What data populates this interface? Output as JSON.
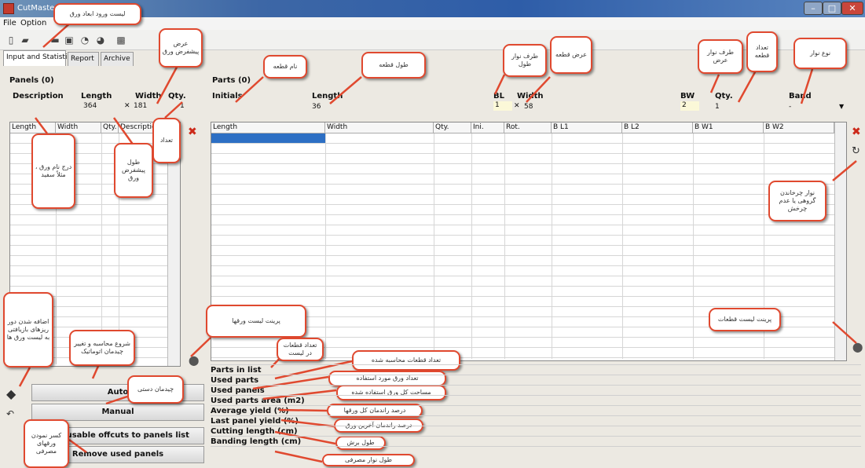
{
  "window": {
    "title": "CutMaste",
    "min": "–",
    "max": "□",
    "close": "✕"
  },
  "menu": {
    "file": "File",
    "options": "Option"
  },
  "tabs": [
    "Input and Statistics",
    "Report",
    "Archive"
  ],
  "panels": {
    "title": "Panels (0)",
    "desc_header": "Description",
    "length_header": "Length",
    "width_header": "Width",
    "qty_header": "Qty.",
    "length": "364",
    "width": "181",
    "qty": "1",
    "times": "✕",
    "grid_cols": [
      "Length",
      "Width",
      "Qty.",
      "Description"
    ]
  },
  "parts": {
    "title": "Parts (0)",
    "initials_header": "Initials",
    "length_header": "Length",
    "bl_header": "BL",
    "width_header": "Width",
    "bw_header": "BW",
    "qty_header": "Qty.",
    "band_header": "Band",
    "length": "36",
    "bl": "1",
    "width": "58",
    "bw": "2",
    "qty": "1",
    "band": "-",
    "times": "✕",
    "grid_cols": [
      "Length",
      "Width",
      "Qty.",
      "Ini.",
      "Rot.",
      "B L1",
      "B L2",
      "B W1",
      "B W2"
    ]
  },
  "buttons": {
    "auto": "Auto",
    "manual": "Manual",
    "add_offcuts": "Add usable offcuts to panels list",
    "remove_used": "Remove used panels"
  },
  "stats": [
    "Parts in list",
    "Used parts",
    "Used panels",
    "Used parts area (m2)",
    "Average yield (%)",
    "Last panel yield (%)",
    "Cutting length (cm)",
    "Banding length (cm)"
  ],
  "callouts": {
    "c1": "لیست ورود ابعاد ورق",
    "c2": "عرض پیشفرض ورق",
    "c3": "نام قطعه",
    "c4": "طول قطعه",
    "c5": "طرف نوار طول",
    "c6": "عرض قطعه",
    "c7": "طرف نوار عرض",
    "c8": "تعداد قطعه",
    "c9": "نوع نوار",
    "c10": "درج نام ورق ، مثلاً سفید",
    "c11": "طول پیشفرض ورق",
    "c12": "تعداد",
    "c13": "نوار چرخاندن گروهی یا عدم چرخش",
    "c14": "پرینت لیست ورقها",
    "c15": "اضافه شدن دور ریزهای بازیافتی به لیست ورق ها",
    "c16": "شروع محاسبه و تغییر چیدمان اتوماتیک",
    "c17": "تعداد قطعات در لیست",
    "c18": "تعداد قطعات محاسبه شده",
    "c19": "پرینت لیست قطعات",
    "c20": "چیدمان دستی",
    "c21": "تعداد ورق مورد استفاده",
    "c22": "مساحت کل ورق استفاده شده",
    "c23": "درصد راندمان کل ورقها",
    "c24": "درصد راندمان آخرین ورق",
    "c25": "طول برش",
    "c26": "کسر نمودن ورقهای مصرفی",
    "c27": "طول نوار مصرفی"
  },
  "colors": {
    "callout_border": "#e0492f",
    "accent": "#2d6fc4",
    "delete": "#cc2a1a"
  }
}
